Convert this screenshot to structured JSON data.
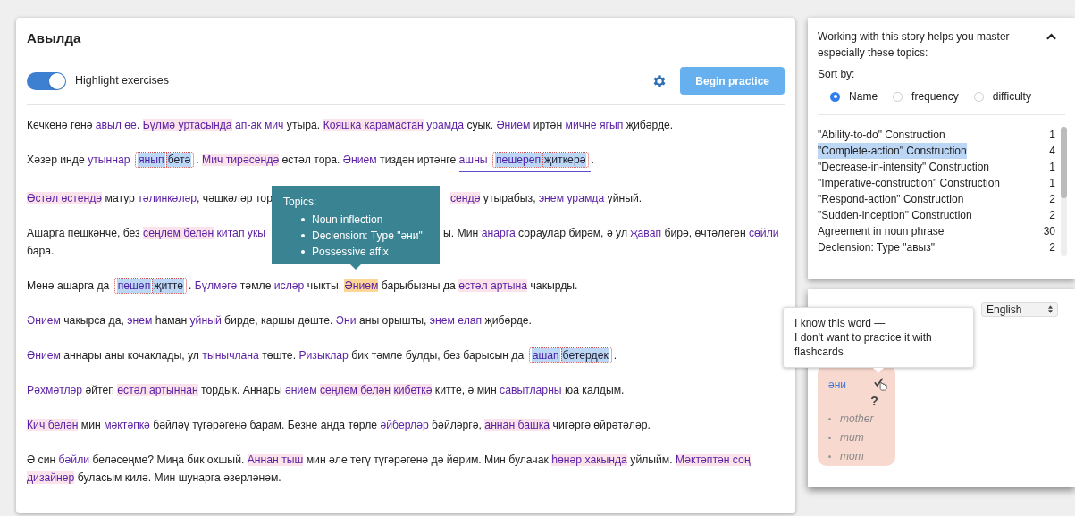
{
  "story": {
    "title": "Авылда",
    "highlight_toggle": {
      "label": "Highlight exercises",
      "on": true
    },
    "begin_button": "Begin practice",
    "paragraphs": [
      [
        {
          "kind": "plain",
          "text": "Кечкенә генә "
        },
        {
          "kind": "word",
          "text": "авыл өе"
        },
        {
          "kind": "plain",
          "text": ". "
        },
        {
          "kind": "phrase",
          "text": "Бүлмә уртасында"
        },
        {
          "kind": "space"
        },
        {
          "kind": "word",
          "text": "ап-ак мич"
        },
        {
          "kind": "plain",
          "text": " утыра. "
        },
        {
          "kind": "phrase",
          "text": "Кояшка карамастан"
        },
        {
          "kind": "space"
        },
        {
          "kind": "word",
          "text": "урамда"
        },
        {
          "kind": "plain",
          "text": " суык. "
        },
        {
          "kind": "word",
          "text": "Әнием"
        },
        {
          "kind": "plain",
          "text": " иртән "
        },
        {
          "kind": "word",
          "text": "мичне ягып"
        },
        {
          "kind": "plain",
          "text": " җибәрде."
        }
      ],
      [
        {
          "kind": "plain",
          "text": "Хәзер инде "
        },
        {
          "kind": "word",
          "text": "утыннар"
        },
        {
          "kind": "space"
        },
        {
          "kind": "exercise",
          "parts": [
            "янып",
            "бетә"
          ]
        },
        {
          "kind": "plain",
          "text": ". "
        },
        {
          "kind": "phrase",
          "text": "Мич тирәсендә"
        },
        {
          "kind": "plain",
          "text": " өстәл тора. "
        },
        {
          "kind": "word",
          "text": "Әнием"
        },
        {
          "kind": "plain",
          "text": " тиздән иртәнге "
        },
        {
          "kind": "underline",
          "parts": [
            {
              "kind": "word",
              "text": "ашны"
            },
            {
              "kind": "space"
            },
            {
              "kind": "exercise",
              "parts": [
                "пешереп",
                "җиткерә"
              ]
            }
          ]
        },
        {
          "kind": "plain",
          "text": "."
        }
      ],
      [
        {
          "kind": "phrase",
          "text": "Өстәл өстендә"
        },
        {
          "kind": "plain",
          "text": " матур "
        },
        {
          "kind": "word",
          "text": "тәлинкәләр"
        },
        {
          "kind": "plain",
          "text": ", чәшкәләр тор"
        },
        {
          "kind": "covered"
        },
        {
          "kind": "phrase",
          "text": "сендә"
        },
        {
          "kind": "plain",
          "text": " утырабыз, "
        },
        {
          "kind": "word",
          "text": "энем урамда"
        },
        {
          "kind": "plain",
          "text": " уйный."
        }
      ],
      [
        {
          "kind": "plain",
          "text": "Ашарга пешкәнче, без "
        },
        {
          "kind": "phrase",
          "text": "сеңлем белән"
        },
        {
          "kind": "space"
        },
        {
          "kind": "word",
          "text": "китап укы"
        },
        {
          "kind": "covered"
        },
        {
          "kind": "plain",
          "text": "ы. Мин "
        },
        {
          "kind": "word",
          "text": "анарга"
        },
        {
          "kind": "plain",
          "text": " сораулар бирәм, ә ул "
        },
        {
          "kind": "word",
          "text": "җавап"
        },
        {
          "kind": "plain",
          "text": " бирә, өчтәлеген "
        },
        {
          "kind": "word",
          "text": "сөйли"
        },
        {
          "kind": "space"
        },
        {
          "kind": "plain",
          "text": "бара."
        }
      ],
      [
        {
          "kind": "plain",
          "text": "Менә ашарга да "
        },
        {
          "kind": "exercise",
          "parts": [
            "пешеп",
            "җитте"
          ]
        },
        {
          "kind": "plain",
          "text": ". "
        },
        {
          "kind": "word",
          "text": "Бүлмәгә"
        },
        {
          "kind": "plain",
          "text": " тәмле "
        },
        {
          "kind": "word",
          "text": "исләр"
        },
        {
          "kind": "plain",
          "text": " чыкты. "
        },
        {
          "kind": "active",
          "text": "Әнием"
        },
        {
          "kind": "plain",
          "text": " барыбызны да "
        },
        {
          "kind": "phrase",
          "text": "өстәл артына"
        },
        {
          "kind": "plain",
          "text": " чакырды."
        }
      ],
      [
        {
          "kind": "word",
          "text": "Әнием"
        },
        {
          "kind": "plain",
          "text": " чакырса да, "
        },
        {
          "kind": "word",
          "text": "энем"
        },
        {
          "kind": "plain",
          "text": " һаман "
        },
        {
          "kind": "word",
          "text": "уйный"
        },
        {
          "kind": "plain",
          "text": " бирде, каршы дәште. "
        },
        {
          "kind": "word",
          "text": "Әни"
        },
        {
          "kind": "plain",
          "text": " аны орышты, "
        },
        {
          "kind": "word",
          "text": "энем елап"
        },
        {
          "kind": "plain",
          "text": " җибәрде."
        }
      ],
      [
        {
          "kind": "word",
          "text": "Әнием"
        },
        {
          "kind": "plain",
          "text": " аннары аны кочаклады, ул "
        },
        {
          "kind": "word",
          "text": "тынычлана"
        },
        {
          "kind": "plain",
          "text": " төште. "
        },
        {
          "kind": "word",
          "text": "Ризыклар"
        },
        {
          "kind": "plain",
          "text": " бик тәмле булды, без барысын да "
        },
        {
          "kind": "exercise",
          "parts": [
            "ашап",
            "бетердек"
          ]
        },
        {
          "kind": "plain",
          "text": "."
        }
      ],
      [
        {
          "kind": "word",
          "text": "Рәхмәтләр"
        },
        {
          "kind": "plain",
          "text": " әйтеп "
        },
        {
          "kind": "phrase",
          "text": "өстәл артыннан"
        },
        {
          "kind": "plain",
          "text": " тордык. Аннары "
        },
        {
          "kind": "word",
          "text": "әнием"
        },
        {
          "kind": "space"
        },
        {
          "kind": "phrase",
          "text": "сеңлем белән"
        },
        {
          "kind": "space"
        },
        {
          "kind": "phrase",
          "text": "кибеткә"
        },
        {
          "kind": "plain",
          "text": " китте, ә мин "
        },
        {
          "kind": "word",
          "text": "савытларны"
        },
        {
          "kind": "plain",
          "text": " юа калдым."
        }
      ],
      [
        {
          "kind": "phrase",
          "text": "Кич белән"
        },
        {
          "kind": "plain",
          "text": " мин "
        },
        {
          "kind": "word",
          "text": "мәктәпкә"
        },
        {
          "kind": "plain",
          "text": " бәйләү түгәрәгенә барам. Безне анда төрле "
        },
        {
          "kind": "word",
          "text": "әйберләр"
        },
        {
          "kind": "plain",
          "text": " бәйләргә, "
        },
        {
          "kind": "phrase",
          "text": "аннан башка"
        },
        {
          "kind": "plain",
          "text": " чигәргә өйрәтәләр."
        }
      ],
      [
        {
          "kind": "plain",
          "text": "Ә син "
        },
        {
          "kind": "word",
          "text": "бәйли"
        },
        {
          "kind": "plain",
          "text": " беләсеңме? Миңа бик охшый. "
        },
        {
          "kind": "phrase",
          "text": "Аннан тыш"
        },
        {
          "kind": "plain",
          "text": " мин әле тегү түгәрәгенә дә йөрим. Мин булачак "
        },
        {
          "kind": "phrase",
          "text": "һөнәр хакында"
        },
        {
          "kind": "plain",
          "text": " уйлыйм. "
        },
        {
          "kind": "phrase",
          "text": "Мәктәптән соң"
        },
        {
          "kind": "space"
        },
        {
          "kind": "phrase",
          "text": "дизайнер"
        },
        {
          "kind": "plain",
          "text": " буласым килә. Мин шунарга әзерләнәм."
        }
      ]
    ],
    "tooltip": {
      "heading": "Topics:",
      "items": [
        "Noun inflection",
        "Declension: Type \"әни\"",
        "Possessive affix"
      ]
    }
  },
  "topics_panel": {
    "intro": "Working with this story helps you master especially these topics:",
    "expanded": true,
    "sort_label": "Sort by:",
    "sort_options": [
      {
        "label": "Name",
        "selected": true
      },
      {
        "label": "frequency",
        "selected": false
      },
      {
        "label": "difficulty",
        "selected": false
      }
    ],
    "topics": [
      {
        "name": "\"Ability-to-do\" Construction",
        "count": "1",
        "selected": false
      },
      {
        "name": "\"Complete-action\" Construction",
        "count": "4",
        "selected": true
      },
      {
        "name": "\"Decrease-in-intensity\" Construction",
        "count": "1",
        "selected": false
      },
      {
        "name": "\"Imperative-construction\" Construction",
        "count": "1",
        "selected": false
      },
      {
        "name": "\"Respond-action\" Construction",
        "count": "2",
        "selected": false
      },
      {
        "name": "\"Sudden-inception\" Construction",
        "count": "2",
        "selected": false
      },
      {
        "name": "Agreement in noun phrase",
        "count": "30",
        "selected": false
      },
      {
        "name": "Declension: Type \"авыз\"",
        "count": "2",
        "selected": false
      }
    ]
  },
  "translation_panel": {
    "language": "English",
    "tooltip": "I know this word —\nI don't want to practice it with flashcards",
    "card": {
      "word": "әни",
      "mark": "?",
      "meanings": [
        "mother",
        "mum",
        "mom"
      ]
    }
  }
}
